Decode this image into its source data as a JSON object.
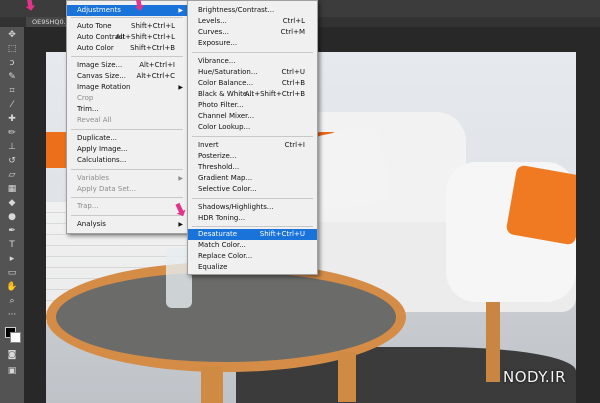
{
  "document_tab": "OE9SHQ0.j",
  "image_menu": {
    "items": [
      {
        "label": "Adjustments",
        "shortcut": "",
        "submenu": true,
        "highlighted": true,
        "disabled": false
      },
      {
        "label": "Auto Tone",
        "shortcut": "Shift+Ctrl+L",
        "disabled": false
      },
      {
        "label": "Auto Contrast",
        "shortcut": "Alt+Shift+Ctrl+L",
        "disabled": false
      },
      {
        "label": "Auto Color",
        "shortcut": "Shift+Ctrl+B",
        "disabled": false
      },
      {
        "label": "Image Size...",
        "shortcut": "Alt+Ctrl+I",
        "disabled": false
      },
      {
        "label": "Canvas Size...",
        "shortcut": "Alt+Ctrl+C",
        "disabled": false
      },
      {
        "label": "Image Rotation",
        "shortcut": "",
        "submenu": true,
        "disabled": false
      },
      {
        "label": "Crop",
        "shortcut": "",
        "disabled": true
      },
      {
        "label": "Trim...",
        "shortcut": "",
        "disabled": false
      },
      {
        "label": "Reveal All",
        "shortcut": "",
        "disabled": true
      },
      {
        "label": "Duplicate...",
        "shortcut": "",
        "disabled": false
      },
      {
        "label": "Apply Image...",
        "shortcut": "",
        "disabled": false
      },
      {
        "label": "Calculations...",
        "shortcut": "",
        "disabled": false
      },
      {
        "label": "Variables",
        "shortcut": "",
        "submenu": true,
        "disabled": true
      },
      {
        "label": "Apply Data Set...",
        "shortcut": "",
        "disabled": true
      },
      {
        "label": "Trap...",
        "shortcut": "",
        "disabled": true
      },
      {
        "label": "Analysis",
        "shortcut": "",
        "submenu": true,
        "disabled": false
      }
    ]
  },
  "adjustments_menu": {
    "items": [
      {
        "label": "Brightness/Contrast...",
        "shortcut": ""
      },
      {
        "label": "Levels...",
        "shortcut": "Ctrl+L"
      },
      {
        "label": "Curves...",
        "shortcut": "Ctrl+M"
      },
      {
        "label": "Exposure...",
        "shortcut": ""
      },
      {
        "label": "Vibrance...",
        "shortcut": ""
      },
      {
        "label": "Hue/Saturation...",
        "shortcut": "Ctrl+U"
      },
      {
        "label": "Color Balance...",
        "shortcut": "Ctrl+B"
      },
      {
        "label": "Black & White...",
        "shortcut": "Alt+Shift+Ctrl+B"
      },
      {
        "label": "Photo Filter...",
        "shortcut": ""
      },
      {
        "label": "Channel Mixer...",
        "shortcut": ""
      },
      {
        "label": "Color Lookup...",
        "shortcut": ""
      },
      {
        "label": "Invert",
        "shortcut": "Ctrl+I"
      },
      {
        "label": "Posterize...",
        "shortcut": ""
      },
      {
        "label": "Threshold...",
        "shortcut": ""
      },
      {
        "label": "Gradient Map...",
        "shortcut": ""
      },
      {
        "label": "Selective Color...",
        "shortcut": ""
      },
      {
        "label": "Shadows/Highlights...",
        "shortcut": ""
      },
      {
        "label": "HDR Toning...",
        "shortcut": ""
      },
      {
        "label": "Desaturate",
        "shortcut": "Shift+Ctrl+U",
        "highlighted": true
      },
      {
        "label": "Match Color...",
        "shortcut": ""
      },
      {
        "label": "Replace Color...",
        "shortcut": ""
      },
      {
        "label": "Equalize",
        "shortcut": ""
      }
    ]
  },
  "watermark": "NODY.IR",
  "colors": {
    "highlight": "#1a73d9",
    "annotation_arrow": "#e3338a",
    "menu_bg": "#f0f0f0"
  }
}
